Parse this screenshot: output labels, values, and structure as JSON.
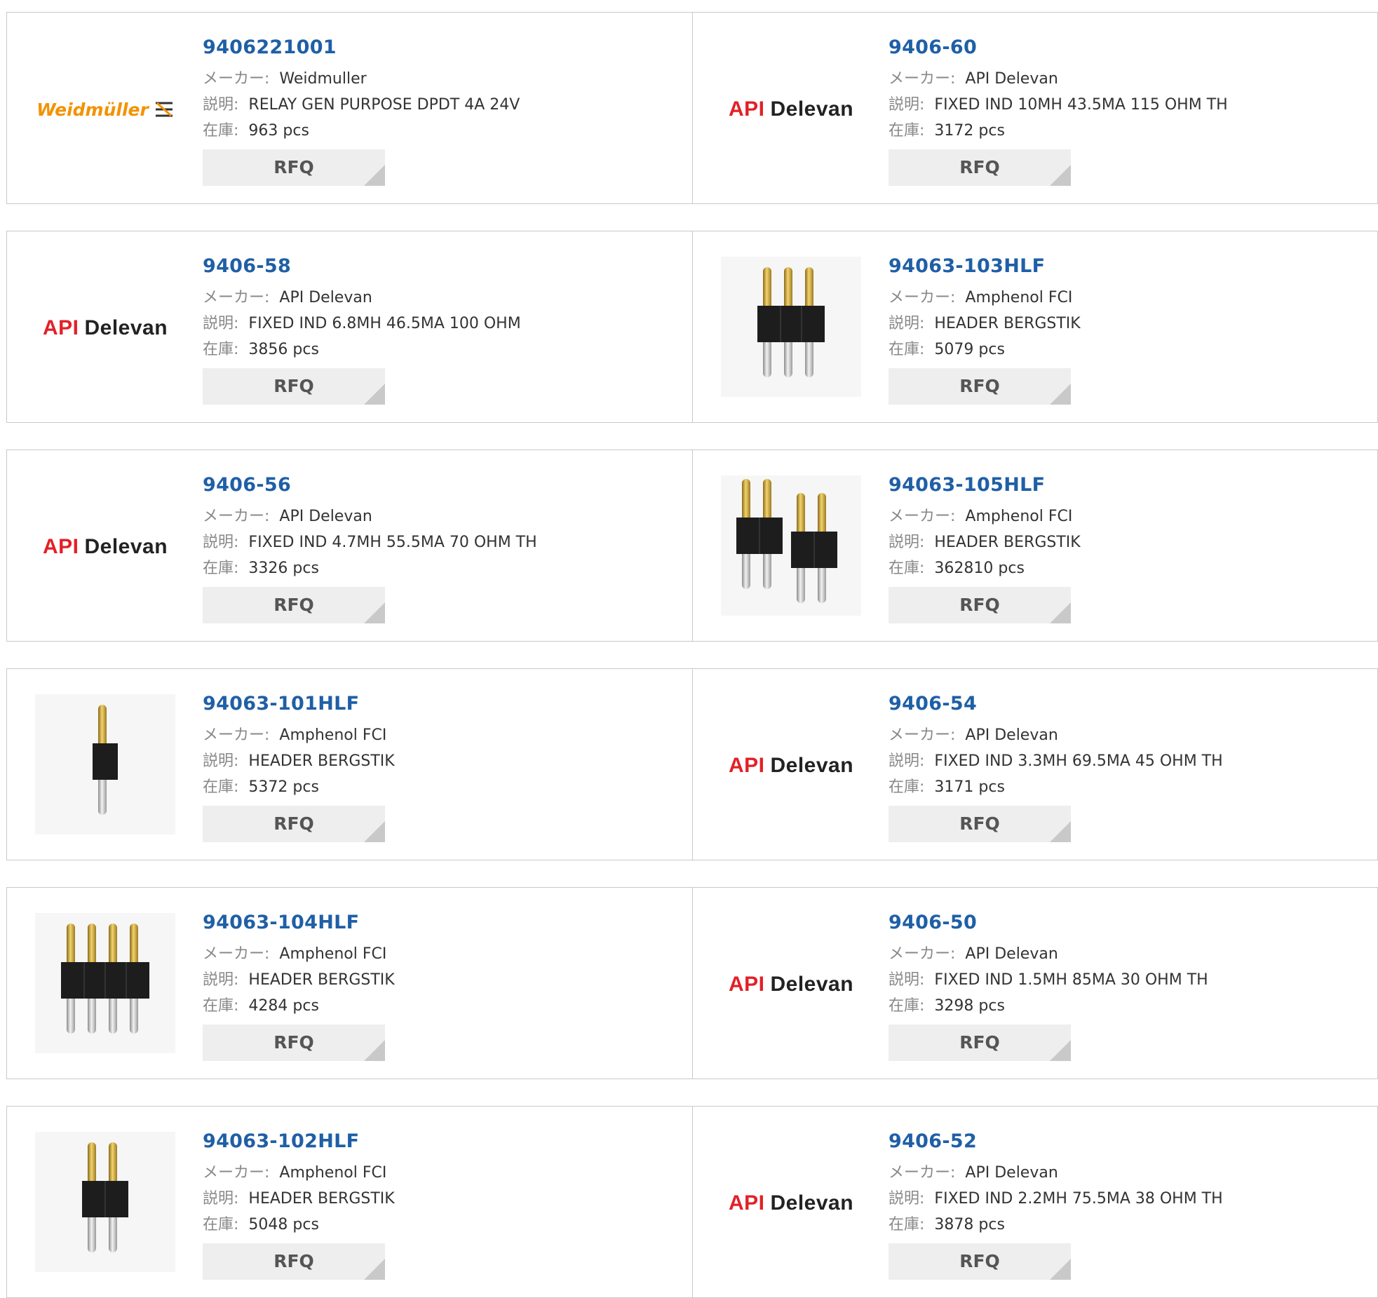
{
  "labels": {
    "manufacturer": "メーカー:",
    "description": "説明:",
    "stock": "在庫:",
    "rfq": "RFQ"
  },
  "products": [
    {
      "part_number": "9406221001",
      "manufacturer": "Weidmuller",
      "description": "RELAY GEN PURPOSE DPDT 4A 24V",
      "stock": "963 pcs",
      "logo": "weidmuller-logo",
      "logo_text": "Weidmüller"
    },
    {
      "part_number": "9406-60",
      "manufacturer": "API Delevan",
      "description": "FIXED IND 10MH 43.5MA 115 OHM TH",
      "stock": "3172 pcs",
      "logo": "api-delevan-logo"
    },
    {
      "part_number": "9406-58",
      "manufacturer": "API Delevan",
      "description": "FIXED IND 6.8MH 46.5MA 100 OHM",
      "stock": "3856 pcs",
      "logo": "api-delevan-logo"
    },
    {
      "part_number": "94063-103HLF",
      "manufacturer": "Amphenol FCI",
      "description": "HEADER BERGSTIK",
      "stock": "5079 pcs",
      "logo": "pin-header-3",
      "pins": 3
    },
    {
      "part_number": "9406-56",
      "manufacturer": "API Delevan",
      "description": "FIXED IND 4.7MH 55.5MA 70 OHM TH",
      "stock": "3326 pcs",
      "logo": "api-delevan-logo"
    },
    {
      "part_number": "94063-105HLF",
      "manufacturer": "Amphenol FCI",
      "description": "HEADER BERGSTIK",
      "stock": "362810 pcs",
      "logo": "pin-header-split",
      "pins": 4
    },
    {
      "part_number": "94063-101HLF",
      "manufacturer": "Amphenol FCI",
      "description": "HEADER BERGSTIK",
      "stock": "5372 pcs",
      "logo": "pin-header-1",
      "pins": 1
    },
    {
      "part_number": "9406-54",
      "manufacturer": "API Delevan",
      "description": "FIXED IND 3.3MH 69.5MA 45 OHM TH",
      "stock": "3171 pcs",
      "logo": "api-delevan-logo"
    },
    {
      "part_number": "94063-104HLF",
      "manufacturer": "Amphenol FCI",
      "description": "HEADER BERGSTIK",
      "stock": "4284 pcs",
      "logo": "pin-header-4",
      "pins": 4
    },
    {
      "part_number": "9406-50",
      "manufacturer": "API Delevan",
      "description": "FIXED IND 1.5MH 85MA 30 OHM TH",
      "stock": "3298 pcs",
      "logo": "api-delevan-logo"
    },
    {
      "part_number": "94063-102HLF",
      "manufacturer": "Amphenol FCI",
      "description": "HEADER BERGSTIK",
      "stock": "5048 pcs",
      "logo": "pin-header-2",
      "pins": 2
    },
    {
      "part_number": "9406-52",
      "manufacturer": "API Delevan",
      "description": "FIXED IND 2.2MH 75.5MA 38 OHM TH",
      "stock": "3878 pcs",
      "logo": "api-delevan-logo"
    }
  ],
  "colors": {
    "part_number": "#1f5fa6",
    "label": "#888888",
    "api_red": "#e32027",
    "weidmuller_orange": "#f39200",
    "rfq_bg": "#eeeeee"
  }
}
